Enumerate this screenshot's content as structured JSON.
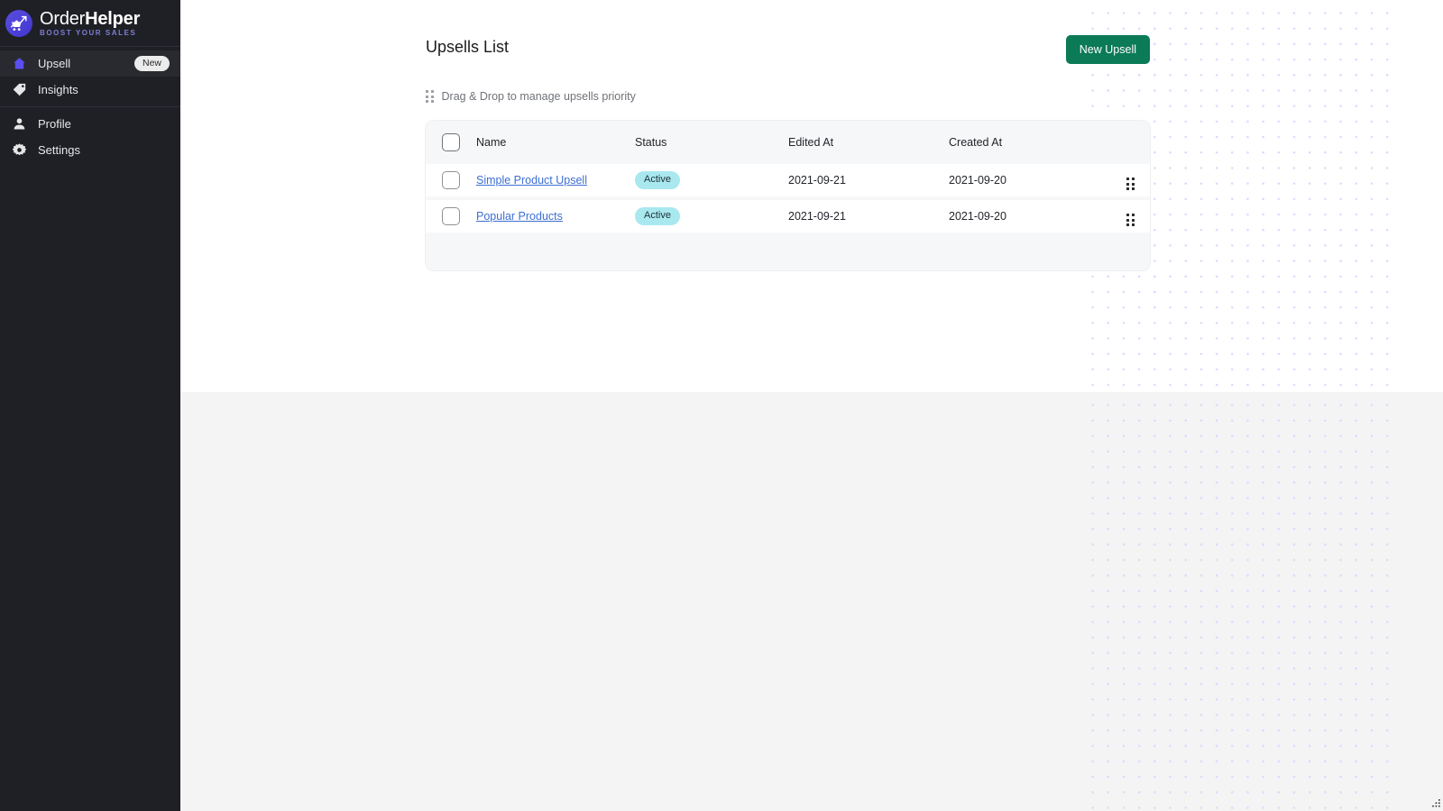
{
  "brand": {
    "name_light": "Order",
    "name_bold": "Helper",
    "tagline": "BOOST YOUR SALES",
    "logo_icon": "shopping-cart-growth-icon",
    "logo_color": "#4a3ed4",
    "tagline_color": "#7f7dd6"
  },
  "sidebar": {
    "groups": [
      {
        "items": [
          {
            "label": "Upsell",
            "icon": "home-icon",
            "active": true,
            "badge": "New"
          },
          {
            "label": "Insights",
            "icon": "tag-icon",
            "active": false,
            "badge": ""
          }
        ]
      },
      {
        "items": [
          {
            "label": "Profile",
            "icon": "user-icon",
            "active": false,
            "badge": ""
          },
          {
            "label": "Settings",
            "icon": "gear-icon",
            "active": false,
            "badge": ""
          }
        ]
      }
    ]
  },
  "page": {
    "title": "Upsells List",
    "new_button": "New Upsell",
    "new_button_color": "#0b7a57",
    "drag_hint": "Drag & Drop to manage upsells priority",
    "drag_hint_icon": "drag-dots-icon"
  },
  "table": {
    "columns": [
      "Name",
      "Status",
      "Edited At",
      "Created At"
    ],
    "select_all_checked": false,
    "rows": [
      {
        "name": "Simple Product Upsell",
        "status": "Active",
        "edited_at": "2021-09-21",
        "created_at": "2021-09-20",
        "checked": false,
        "drag_icon": "drag-dots-icon"
      },
      {
        "name": "Popular Products",
        "status": "Active",
        "edited_at": "2021-09-21",
        "created_at": "2021-09-20",
        "checked": false,
        "drag_icon": "drag-dots-icon"
      }
    ],
    "status_badge_color": "#a9e8ef",
    "link_color": "#3d6fd3"
  }
}
